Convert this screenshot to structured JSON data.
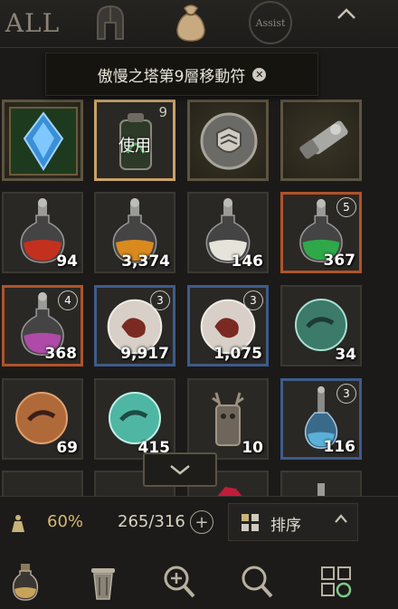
{
  "tabs": {
    "all_label": "ALL",
    "assist_label": "Assist"
  },
  "tooltip": {
    "text": "傲慢之塔第9層移動符"
  },
  "row1": [
    {
      "name": "blue-crystal",
      "count": ""
    },
    {
      "name": "teleport-scroll",
      "badge_num": "9",
      "action": "使用"
    },
    {
      "name": "shield-emblem",
      "count": ""
    },
    {
      "name": "silver-scroll",
      "count": ""
    }
  ],
  "row2": [
    {
      "name": "red-potion",
      "count": "94"
    },
    {
      "name": "orange-potion",
      "count": "3,374"
    },
    {
      "name": "white-potion",
      "count": "146"
    },
    {
      "name": "green-potion",
      "count": "367",
      "badge": "5"
    }
  ],
  "row3": [
    {
      "name": "purple-potion",
      "count": "368",
      "badge": "4"
    },
    {
      "name": "dragon-orb-red",
      "count": "9,917",
      "badge": "3"
    },
    {
      "name": "dragon-orb-red-2",
      "count": "1,075",
      "badge": "3"
    },
    {
      "name": "green-orb",
      "count": "34"
    }
  ],
  "row4": [
    {
      "name": "orange-orb",
      "count": "69"
    },
    {
      "name": "teal-orb",
      "count": "415"
    },
    {
      "name": "antler-totem",
      "count": "10"
    },
    {
      "name": "blue-vial",
      "count": "116",
      "badge": "3"
    }
  ],
  "footer": {
    "weight_percent": "60%",
    "capacity": "265/316",
    "sort_label": "排序"
  },
  "colors": {
    "background": "#1b1a18",
    "weight": "#d6b872",
    "gold_border": "#a5865a",
    "orange_border": "#b0532a",
    "blue_border": "#3e5b8a"
  },
  "icons": [
    "helmet-icon",
    "pouch-icon",
    "potion-icon",
    "trash-icon",
    "zoom-in-icon",
    "search-icon",
    "grid-arrange-icon"
  ]
}
